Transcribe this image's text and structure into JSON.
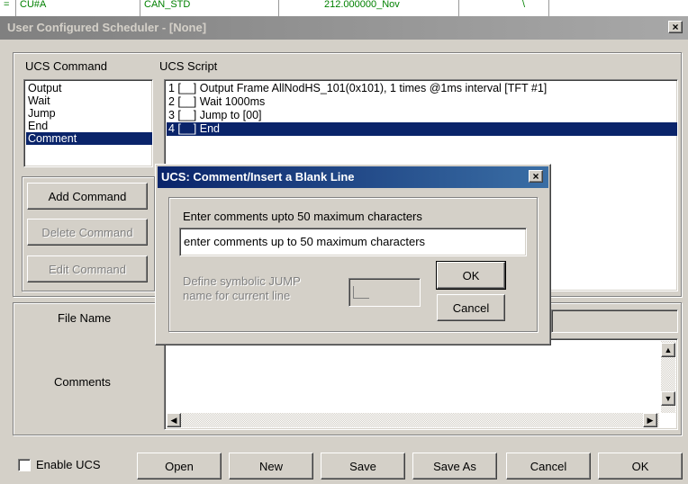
{
  "background": {
    "cells": [
      "CU#A",
      "CAN_STD",
      "212.000000_Nov",
      "\\"
    ]
  },
  "main": {
    "title": "User Configured Scheduler - [None]",
    "close_glyph": "×",
    "ucs_command_label": "UCS Command",
    "ucs_script_label": "UCS Script",
    "commands": [
      "Output",
      "Wait",
      "Jump",
      "End",
      "Comment"
    ],
    "selected_command": 4,
    "script_lines": [
      "1 [__] Output Frame  AllNodHS_101(0x101), 1 times @1ms interval [TFT #1]",
      "2 [__] Wait 1000ms",
      "3 [__] Jump to [00]",
      "4 [__] End"
    ],
    "selected_line": 3,
    "add_command": "Add Command",
    "delete_command": "Delete Command",
    "edit_command": "Edit Command",
    "file_name_label": "File Name",
    "comments_label": "Comments",
    "enable_ucs": "Enable UCS",
    "open": "Open",
    "new": "New",
    "save": "Save",
    "save_as": "Save As",
    "cancel": "Cancel",
    "ok": "OK"
  },
  "dialog": {
    "title": "UCS: Comment/Insert a Blank Line",
    "close_glyph": "×",
    "prompt": "Enter comments upto 50 maximum characters",
    "comment_value": "enter comments up to 50 maximum characters",
    "symbolic_label_1": "Define symbolic JUMP",
    "symbolic_label_2": "name for current line",
    "symbolic_value": "",
    "ok": "OK",
    "cancel": "Cancel"
  }
}
